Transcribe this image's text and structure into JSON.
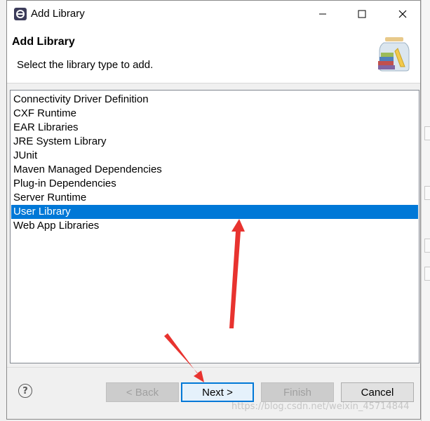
{
  "window": {
    "title": "Add Library",
    "controls": [
      "minimize-icon",
      "maximize-icon",
      "close-icon"
    ]
  },
  "header": {
    "title": "Add Library",
    "subtitle": "Select the library type to add."
  },
  "list": {
    "items": [
      {
        "label": "Connectivity Driver Definition",
        "selected": false
      },
      {
        "label": "CXF Runtime",
        "selected": false
      },
      {
        "label": "EAR Libraries",
        "selected": false
      },
      {
        "label": "JRE System Library",
        "selected": false
      },
      {
        "label": "JUnit",
        "selected": false
      },
      {
        "label": "Maven Managed Dependencies",
        "selected": false
      },
      {
        "label": "Plug-in Dependencies",
        "selected": false
      },
      {
        "label": "Server Runtime",
        "selected": false
      },
      {
        "label": "User Library",
        "selected": true
      },
      {
        "label": "Web App Libraries",
        "selected": false
      }
    ]
  },
  "buttons": {
    "help": "?",
    "back": "< Back",
    "next": "Next >",
    "finish": "Finish",
    "cancel": "Cancel"
  },
  "watermark": "https://blog.csdn.net/weixin_45714844",
  "colors": {
    "selection": "#0078d7",
    "annotation_arrow": "#e8332f"
  }
}
